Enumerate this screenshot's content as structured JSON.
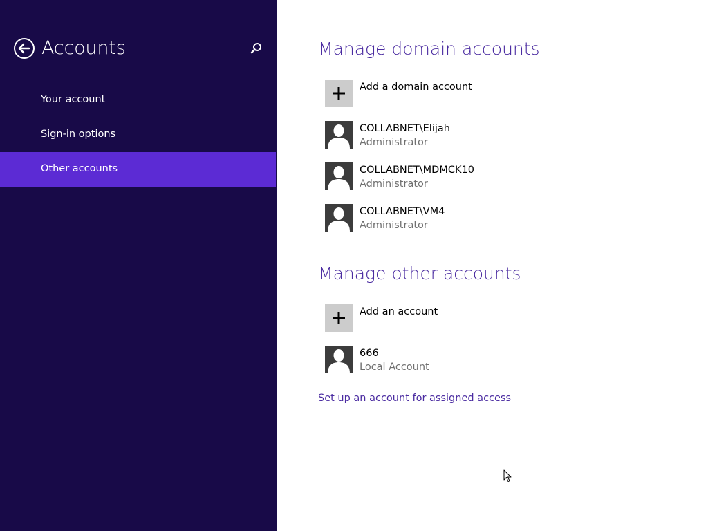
{
  "nav": {
    "title": "Accounts",
    "back_icon": "back-arrow-icon",
    "search_icon": "search-icon",
    "items": [
      {
        "label": "Your account",
        "selected": false
      },
      {
        "label": "Sign-in options",
        "selected": false
      },
      {
        "label": "Other accounts",
        "selected": true
      }
    ]
  },
  "domain_section": {
    "heading": "Manage domain accounts",
    "add_label": "Add a domain account",
    "accounts": [
      {
        "name": "COLLABNET\\Elijah",
        "role": "Administrator"
      },
      {
        "name": "COLLABNET\\MDMCK10",
        "role": "Administrator"
      },
      {
        "name": "COLLABNET\\VM4",
        "role": "Administrator"
      }
    ]
  },
  "other_section": {
    "heading": "Manage other accounts",
    "add_label": "Add an account",
    "accounts": [
      {
        "name": "666",
        "role": "Local Account"
      }
    ]
  },
  "assigned_access_link": "Set up an account for assigned access",
  "colors": {
    "nav_background": "#180a48",
    "nav_selected": "#5c2bd4",
    "accent_text": "#4b2ca1",
    "secondary_text": "#707070"
  }
}
